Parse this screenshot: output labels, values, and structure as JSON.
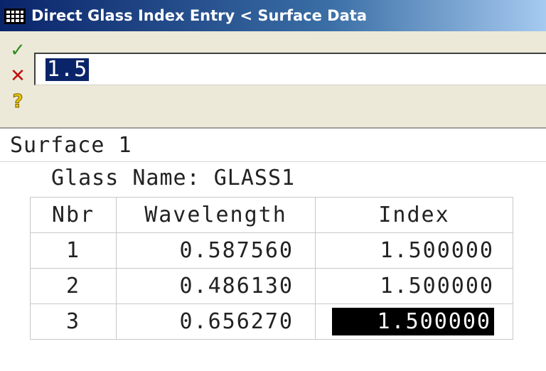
{
  "window": {
    "title": "Direct Glass Index Entry < Surface Data",
    "icon": "table-icon"
  },
  "toolbar": {
    "ok_icon_glyph": "✓",
    "cancel_icon_glyph": "✕",
    "help_icon_glyph": "?"
  },
  "entry": {
    "value": "1.5"
  },
  "surface": {
    "label": "Surface 1"
  },
  "glass": {
    "label": "Glass Name: GLASS1"
  },
  "table": {
    "headers": {
      "nbr": "Nbr",
      "wavelength": "Wavelength",
      "index": "Index"
    },
    "rows": [
      {
        "nbr": "1",
        "wavelength": "0.587560",
        "index": "1.500000"
      },
      {
        "nbr": "2",
        "wavelength": "0.486130",
        "index": "1.500000"
      },
      {
        "nbr": "3",
        "wavelength": "0.656270",
        "index": "1.500000"
      }
    ],
    "selected_row": 3
  },
  "colors": {
    "titlebar_start": "#0a246a",
    "selection": "#0a246a",
    "ok": "#2e8b1f",
    "cancel": "#c01010",
    "help": "#e6c800"
  }
}
